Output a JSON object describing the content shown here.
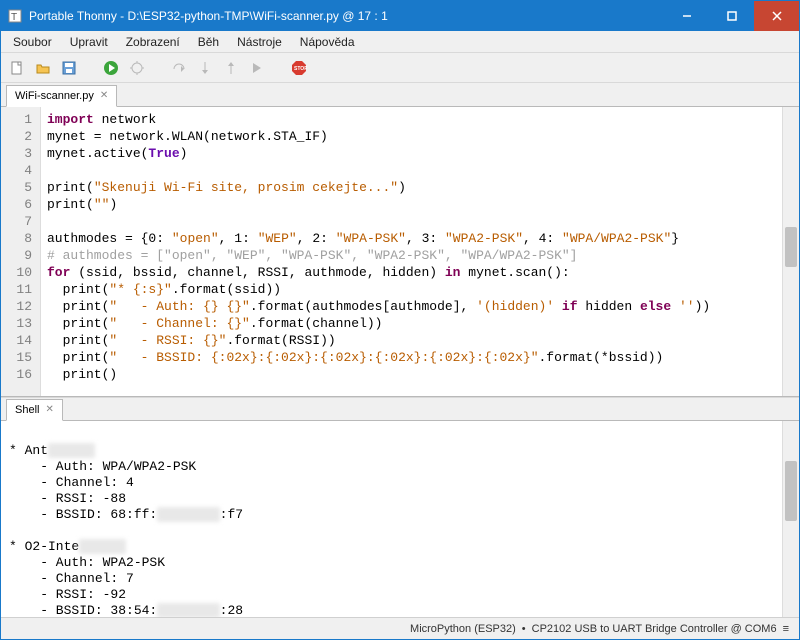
{
  "title": "Portable Thonny  -  D:\\ESP32-python-TMP\\WiFi-scanner.py  @  17 : 1",
  "menu": [
    "Soubor",
    "Upravit",
    "Zobrazení",
    "Běh",
    "Nástroje",
    "Nápověda"
  ],
  "tab": {
    "label": "WiFi-scanner.py"
  },
  "code_lines": 16,
  "shell_tab": "Shell",
  "status": {
    "interpreter": "MicroPython (ESP32)",
    "sep": "•",
    "port": "CP2102 USB to UART Bridge Controller @ COM6",
    "arrow": "≡"
  },
  "code": {
    "l1a": "import",
    "l1b": " network",
    "l2": "mynet = network.WLAN(network.STA_IF)",
    "l3a": "mynet.active(",
    "l3b": "True",
    "l3c": ")",
    "l5a": "print",
    "l5b": "(",
    "l5c": "\"Skenuji Wi-Fi site, prosim cekejte...\"",
    "l5d": ")",
    "l6a": "print",
    "l6b": "(",
    "l6c": "\"\"",
    "l6d": ")",
    "l8a": "authmodes = {",
    "l8o0": "0",
    "l8s0": ": ",
    "l8v0": "\"open\"",
    "l8c": ", ",
    "l8o1": "1",
    "l8v1": "\"WEP\"",
    "l8o2": "2",
    "l8v2": "\"WPA-PSK\"",
    "l8o3": "3",
    "l8v3": "\"WPA2-PSK\"",
    "l8o4": "4",
    "l8v4": "\"WPA/WPA2-PSK\"",
    "l8z": "}",
    "l9": "# authmodes = [\"open\", \"WEP\", \"WPA-PSK\", \"WPA2-PSK\", \"WPA/WPA2-PSK\"]",
    "l10a": "for",
    "l10b": " (ssid, bssid, channel, RSSI, authmode, hidden) ",
    "l10c": "in",
    "l10d": " mynet.scan():",
    "l11a": "  print",
    "l11b": "(",
    "l11c": "\"* {:s}\"",
    "l11d": ".format(ssid))",
    "l12a": "  print",
    "l12b": "(",
    "l12c": "\"   - Auth: {} {}\"",
    "l12d": ".format(authmodes[authmode], ",
    "l12e": "'(hidden)'",
    "l12f": " if ",
    "l12g": "hidden ",
    "l12h": "else",
    "l12i": " ''",
    "l12j": "))",
    "l13a": "  print",
    "l13b": "(",
    "l13c": "\"   - Channel: {}\"",
    "l13d": ".format(channel))",
    "l14a": "  print",
    "l14b": "(",
    "l14c": "\"   - RSSI: {}\"",
    "l14d": ".format(RSSI))",
    "l15a": "  print",
    "l15b": "(",
    "l15c": "\"   - BSSID: {:02x}:{:02x}:{:02x}:{:02x}:{:02x}:{:02x}\"",
    "l15d": ".format(*bssid))",
    "l16a": "  print",
    "l16b": "()"
  },
  "shell": {
    "n1": "* Ant",
    "n1b": "xxxxxx",
    "a1": "    - Auth: WPA/WPA2-PSK",
    "c1": "    - Channel: 4",
    "r1": "    - RSSI: -88",
    "b1a": "    - BSSID: 68:ff:",
    "b1m": "xx:xx:xx",
    "b1b": ":f7",
    "blank": "",
    "n2": "* O2-Inte",
    "n2b": "xxxxxx",
    "a2": "    - Auth: WPA2-PSK",
    "c2": "    - Channel: 7",
    "r2": "    - RSSI: -92",
    "b2a": "    - BSSID: 38:54:",
    "b2m": "xx:xx:xx",
    "b2b": ":28"
  }
}
